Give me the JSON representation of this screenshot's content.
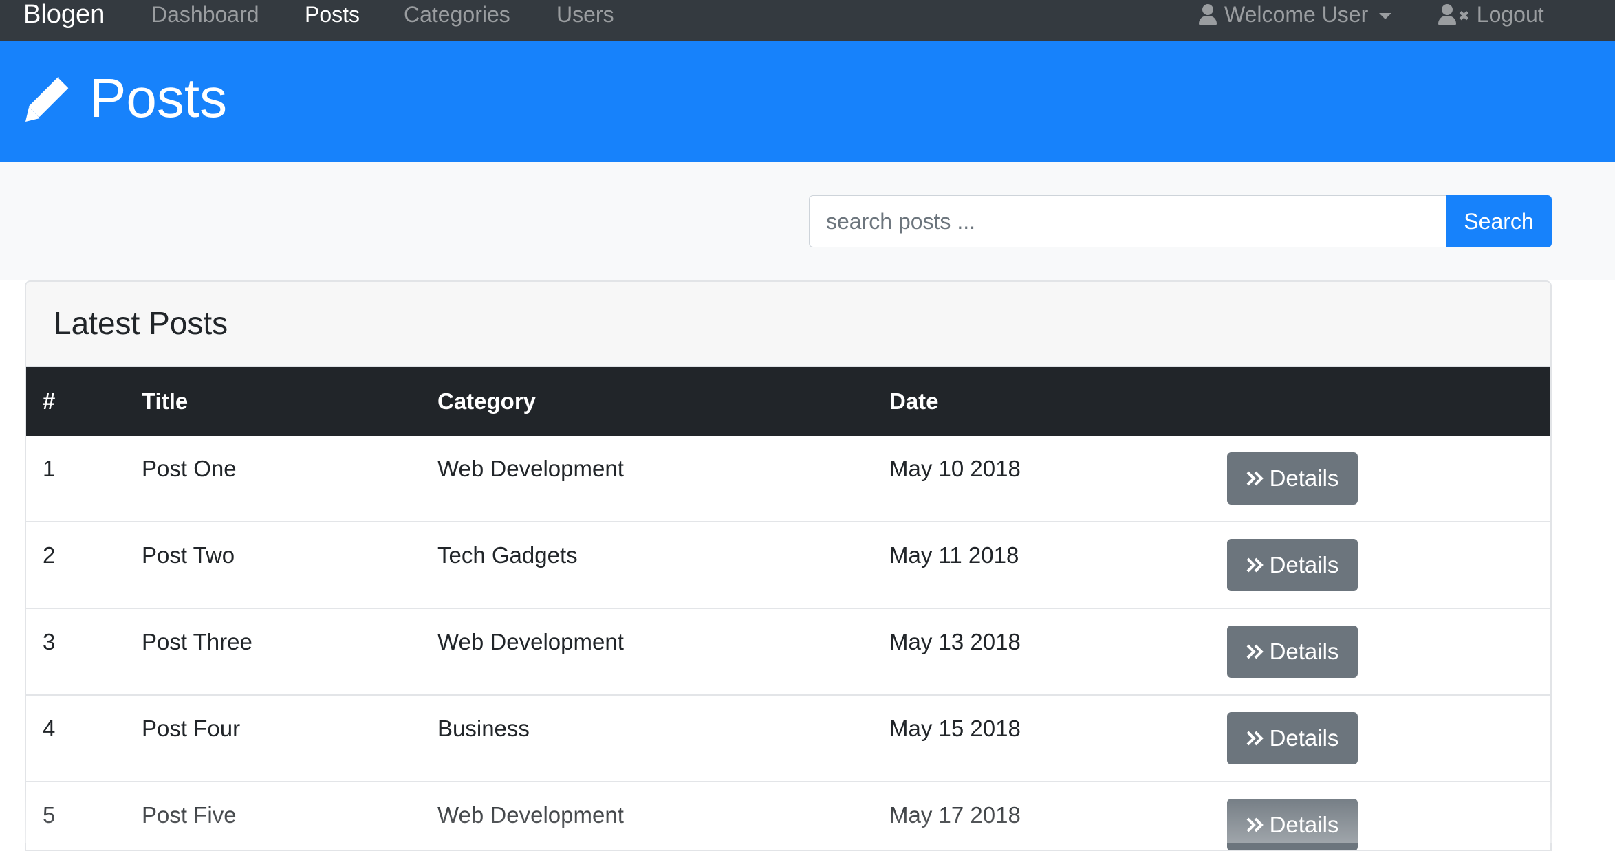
{
  "navbar": {
    "brand": "Blogen",
    "links": [
      {
        "label": "Dashboard",
        "active": false
      },
      {
        "label": "Posts",
        "active": true
      },
      {
        "label": "Categories",
        "active": false
      },
      {
        "label": "Users",
        "active": false
      }
    ],
    "user_menu": {
      "label": "Welcome User",
      "icon": "user-icon"
    },
    "logout": {
      "label": "Logout",
      "icon": "user-times-icon"
    }
  },
  "header": {
    "title": "Posts",
    "icon": "pencil-icon",
    "bg_color": "#1782fb"
  },
  "search": {
    "placeholder": "search posts ...",
    "value": "",
    "button_label": "Search"
  },
  "posts_card": {
    "title": "Latest Posts",
    "columns": [
      "#",
      "Title",
      "Category",
      "Date"
    ],
    "rows": [
      {
        "num": "1",
        "title": "Post One",
        "category": "Web Development",
        "date": "May 10 2018",
        "action": "Details"
      },
      {
        "num": "2",
        "title": "Post Two",
        "category": "Tech Gadgets",
        "date": "May 11 2018",
        "action": "Details"
      },
      {
        "num": "3",
        "title": "Post Three",
        "category": "Web Development",
        "date": "May 13 2018",
        "action": "Details"
      },
      {
        "num": "4",
        "title": "Post Four",
        "category": "Business",
        "date": "May 15 2018",
        "action": "Details"
      },
      {
        "num": "5",
        "title": "Post Five",
        "category": "Web Development",
        "date": "May 17 2018",
        "action": "Details"
      }
    ]
  },
  "colors": {
    "navbar_bg": "#343a40",
    "primary": "#1782fb",
    "table_head_bg": "#212529",
    "secondary_button": "#6c757d"
  }
}
